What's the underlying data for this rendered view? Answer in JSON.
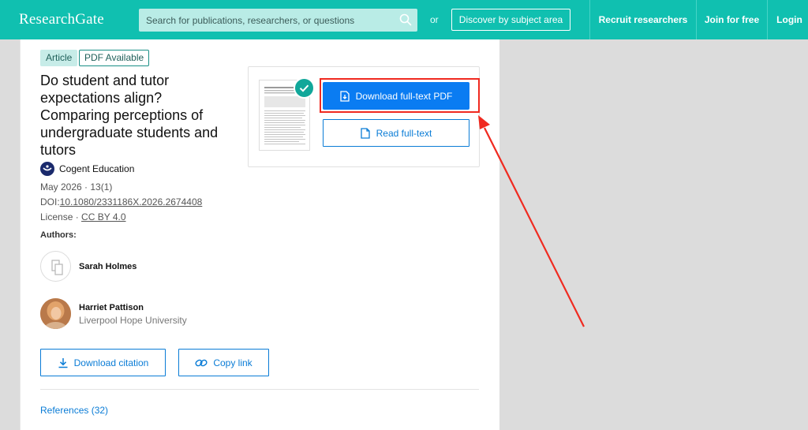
{
  "header": {
    "logo": "ResearchGate",
    "search_placeholder": "Search for publications, researchers, or questions",
    "or_text": "or",
    "discover_label": "Discover by subject area",
    "nav": [
      "Recruit researchers",
      "Join for free",
      "Login"
    ]
  },
  "article": {
    "badges": [
      "Article",
      "PDF Available"
    ],
    "title": "Do student and tutor expectations align? Comparing perceptions of undergraduate students and tutors",
    "journal": "Cogent Education",
    "date_issue": "May 2026 · 13(1)",
    "doi_prefix": "DOI:",
    "doi": "10.1080/2331186X.2026.2674408",
    "license_prefix": "License · ",
    "license": "CC BY 4.0",
    "authors_label": "Authors:",
    "authors": [
      {
        "name": "Sarah Holmes",
        "institution": ""
      },
      {
        "name": "Harriet Pattison",
        "institution": "Liverpool Hope University"
      }
    ],
    "download_citation_label": "Download citation",
    "copy_link_label": "Copy link",
    "references_label": "References (32)"
  },
  "preview": {
    "download_pdf_label": "Download full-text PDF",
    "read_fulltext_label": "Read full-text"
  },
  "colors": {
    "brand": "#10c0b0",
    "primary_blue": "#0a7cf2",
    "annotation_red": "#f02a20"
  }
}
